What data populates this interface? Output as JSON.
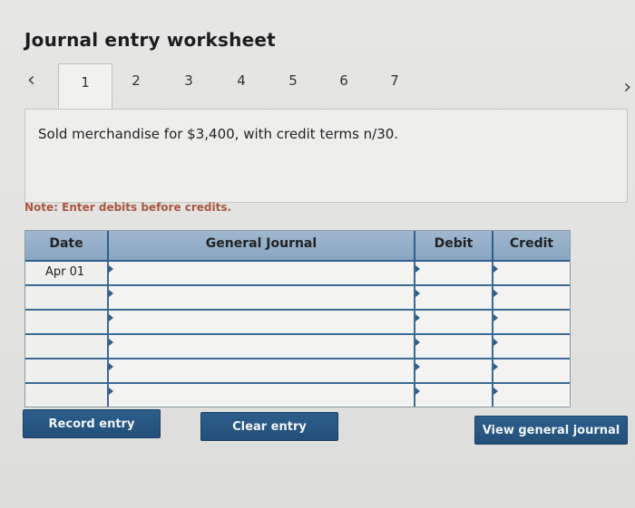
{
  "header": {
    "title": "Journal entry worksheet"
  },
  "tabs": {
    "prev_icon": "‹",
    "next_icon": "›",
    "items": [
      "1",
      "2",
      "3",
      "4",
      "5",
      "6",
      "7"
    ],
    "active": "1"
  },
  "prompt": {
    "text": "Sold merchandise for $3,400, with credit terms n/30."
  },
  "note": {
    "text": "Note: Enter debits before credits."
  },
  "journal": {
    "columns": {
      "date": "Date",
      "general_journal": "General Journal",
      "debit": "Debit",
      "credit": "Credit"
    },
    "rows": [
      {
        "date": "Apr 01",
        "account": "",
        "debit": "",
        "credit": ""
      },
      {
        "date": "",
        "account": "",
        "debit": "",
        "credit": ""
      },
      {
        "date": "",
        "account": "",
        "debit": "",
        "credit": ""
      },
      {
        "date": "",
        "account": "",
        "debit": "",
        "credit": ""
      },
      {
        "date": "",
        "account": "",
        "debit": "",
        "credit": ""
      },
      {
        "date": "",
        "account": "",
        "debit": "",
        "credit": ""
      }
    ]
  },
  "buttons": {
    "record": "Record entry",
    "clear": "Clear entry",
    "view": "View general journal"
  }
}
